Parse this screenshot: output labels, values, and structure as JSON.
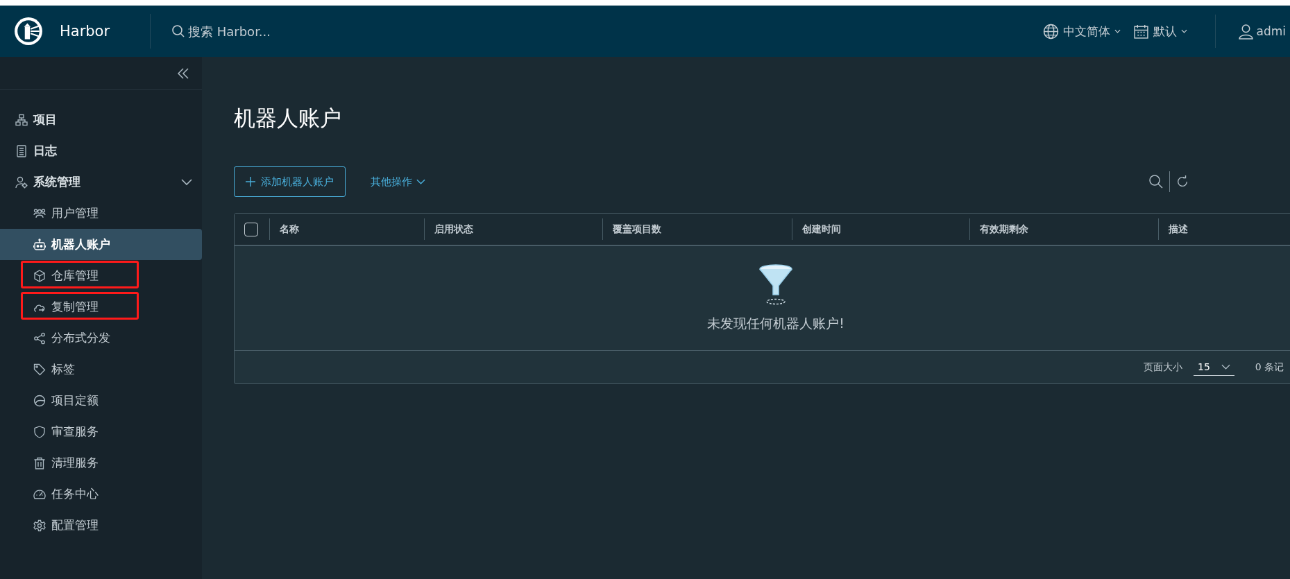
{
  "header": {
    "logo_text": "Harbor",
    "search": {
      "placeholder": "搜索 Harbor..."
    },
    "language": "中文简体",
    "theme": "默认",
    "user": "admi"
  },
  "sidebar": {
    "items": [
      {
        "label": "项目",
        "selected": false
      },
      {
        "label": "日志",
        "selected": false
      },
      {
        "label": "系统管理",
        "selected": false,
        "expanded": true,
        "children": [
          {
            "label": "用户管理",
            "selected": false,
            "marked": false
          },
          {
            "label": "机器人账户",
            "selected": true,
            "marked": false
          },
          {
            "label": "仓库管理",
            "selected": false,
            "marked": true
          },
          {
            "label": "复制管理",
            "selected": false,
            "marked": true
          },
          {
            "label": "分布式分发",
            "selected": false,
            "marked": false
          },
          {
            "label": "标签",
            "selected": false,
            "marked": false
          },
          {
            "label": "项目定额",
            "selected": false,
            "marked": false
          },
          {
            "label": "审查服务",
            "selected": false,
            "marked": false
          },
          {
            "label": "清理服务",
            "selected": false,
            "marked": false
          },
          {
            "label": "任务中心",
            "selected": false,
            "marked": false
          },
          {
            "label": "配置管理",
            "selected": false,
            "marked": false
          }
        ]
      }
    ]
  },
  "page": {
    "title": "机器人账户",
    "add_button": "添加机器人账户",
    "more_actions": "其他操作",
    "table": {
      "select_all_checked": false,
      "columns": [
        "名称",
        "启用状态",
        "覆盖项目数",
        "创建时间",
        "有效期剩余",
        "描述"
      ],
      "empty_message": "未发现任何机器人账户!",
      "page_size_label": "页面大小",
      "page_size": "15",
      "total": "0 条记"
    }
  }
}
